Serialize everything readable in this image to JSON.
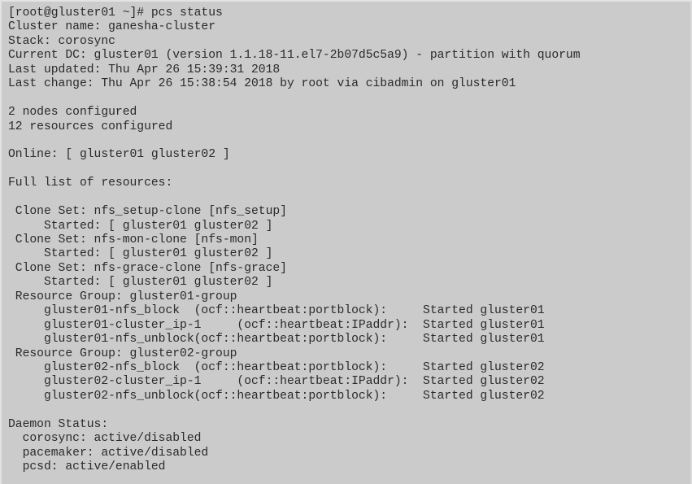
{
  "terminal": {
    "background_color": "#cbcbcb",
    "text_color": "#2a2a2a",
    "prompt": "[root@gluster01 ~]# pcs status",
    "lines": [
      "[root@gluster01 ~]# pcs status",
      "Cluster name: ganesha-cluster",
      "Stack: corosync",
      "Current DC: gluster01 (version 1.1.18-11.el7-2b07d5c5a9) - partition with quorum",
      "Last updated: Thu Apr 26 15:39:31 2018",
      "Last change: Thu Apr 26 15:38:54 2018 by root via cibadmin on gluster01",
      "",
      "2 nodes configured",
      "12 resources configured",
      "",
      "Online: [ gluster01 gluster02 ]",
      "",
      "Full list of resources:",
      "",
      " Clone Set: nfs_setup-clone [nfs_setup]",
      "     Started: [ gluster01 gluster02 ]",
      " Clone Set: nfs-mon-clone [nfs-mon]",
      "     Started: [ gluster01 gluster02 ]",
      " Clone Set: nfs-grace-clone [nfs-grace]",
      "     Started: [ gluster01 gluster02 ]",
      " Resource Group: gluster01-group",
      "     gluster01-nfs_block  (ocf::heartbeat:portblock):     Started gluster01",
      "     gluster01-cluster_ip-1     (ocf::heartbeat:IPaddr):  Started gluster01",
      "     gluster01-nfs_unblock(ocf::heartbeat:portblock):     Started gluster01",
      " Resource Group: gluster02-group",
      "     gluster02-nfs_block  (ocf::heartbeat:portblock):     Started gluster02",
      "     gluster02-cluster_ip-1     (ocf::heartbeat:IPaddr):  Started gluster02",
      "     gluster02-nfs_unblock(ocf::heartbeat:portblock):     Started gluster02",
      "",
      "Daemon Status:",
      "  corosync: active/disabled",
      "  pacemaker: active/disabled",
      "  pcsd: active/enabled"
    ],
    "details": {
      "command": "pcs status",
      "user": "root",
      "host": "gluster01",
      "cluster_name": "ganesha-cluster",
      "stack": "corosync",
      "current_dc": "gluster01",
      "version": "1.1.18-11.el7-2b07d5c5a9",
      "partition": "partition with quorum",
      "last_updated": "Thu Apr 26 15:39:31 2018",
      "last_change": "Thu Apr 26 15:38:54 2018",
      "changed_by": "root",
      "changed_via": "cibadmin",
      "changed_on": "gluster01",
      "nodes_configured": "2",
      "resources_configured": "12",
      "online_nodes": "[ gluster01 gluster02 ]",
      "daemons": [
        {
          "name": "corosync",
          "status": "active/disabled"
        },
        {
          "name": "pacemaker",
          "status": "active/disabled"
        },
        {
          "name": "pcsd",
          "status": "active/enabled"
        }
      ],
      "clone_sets": [
        {
          "name": "nfs_setup-clone",
          "primitive": "[nfs_setup]",
          "started": "[ gluster01 gluster02 ]"
        },
        {
          "name": "nfs-mon-clone",
          "primitive": "[nfs-mon]",
          "started": "[ gluster01 gluster02 ]"
        },
        {
          "name": "nfs-grace-clone",
          "primitive": "[nfs-grace]",
          "started": "[ gluster01 gluster02 ]"
        }
      ],
      "resource_groups": [
        {
          "name": "gluster01-group",
          "resources": [
            {
              "id": "gluster01-nfs_block",
              "agent": "(ocf::heartbeat:portblock):",
              "state": "Started",
              "node": "gluster01"
            },
            {
              "id": "gluster01-cluster_ip-1",
              "agent": "(ocf::heartbeat:IPaddr):",
              "state": "Started",
              "node": "gluster01"
            },
            {
              "id": "gluster01-nfs_unblock",
              "agent": "(ocf::heartbeat:portblock):",
              "state": "Started",
              "node": "gluster01"
            }
          ]
        },
        {
          "name": "gluster02-group",
          "resources": [
            {
              "id": "gluster02-nfs_block",
              "agent": "(ocf::heartbeat:portblock):",
              "state": "Started",
              "node": "gluster02"
            },
            {
              "id": "gluster02-cluster_ip-1",
              "agent": "(ocf::heartbeat:IPaddr):",
              "state": "Started",
              "node": "gluster02"
            },
            {
              "id": "gluster02-nfs_unblock",
              "agent": "(ocf::heartbeat:portblock):",
              "state": "Started",
              "node": "gluster02"
            }
          ]
        }
      ]
    }
  }
}
